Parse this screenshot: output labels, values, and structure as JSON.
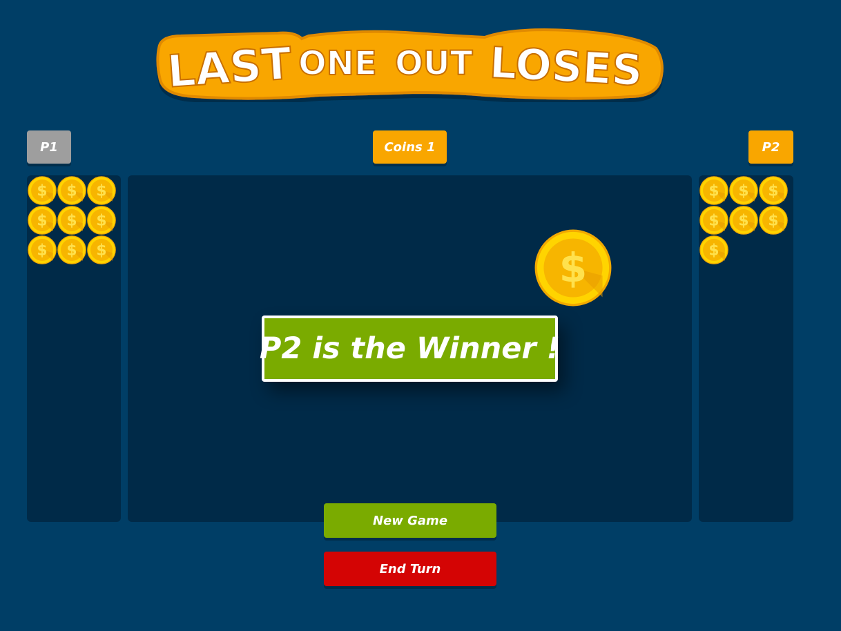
{
  "logo": {
    "words": [
      "LAST",
      "ONE",
      "OUT",
      "LOSES"
    ]
  },
  "players": {
    "p1": {
      "label": "P1",
      "coins": 9,
      "active": false
    },
    "p2": {
      "label": "P2",
      "coins": 7,
      "active": true
    }
  },
  "pile": {
    "label": "Coins 1",
    "remaining": 1
  },
  "winner_message": "P2 is the Winner !",
  "buttons": {
    "new_game": "New Game",
    "end_turn": "End Turn"
  },
  "colors": {
    "background": "#003e66",
    "panel": "#002a48",
    "accent_orange": "#f9a600",
    "inactive_gray": "#9e9e9e",
    "success_green": "#7aab00",
    "danger_red": "#d40404",
    "coin_gold": "#ffd000"
  },
  "icons": {
    "coin": "dollar-coin-icon"
  }
}
